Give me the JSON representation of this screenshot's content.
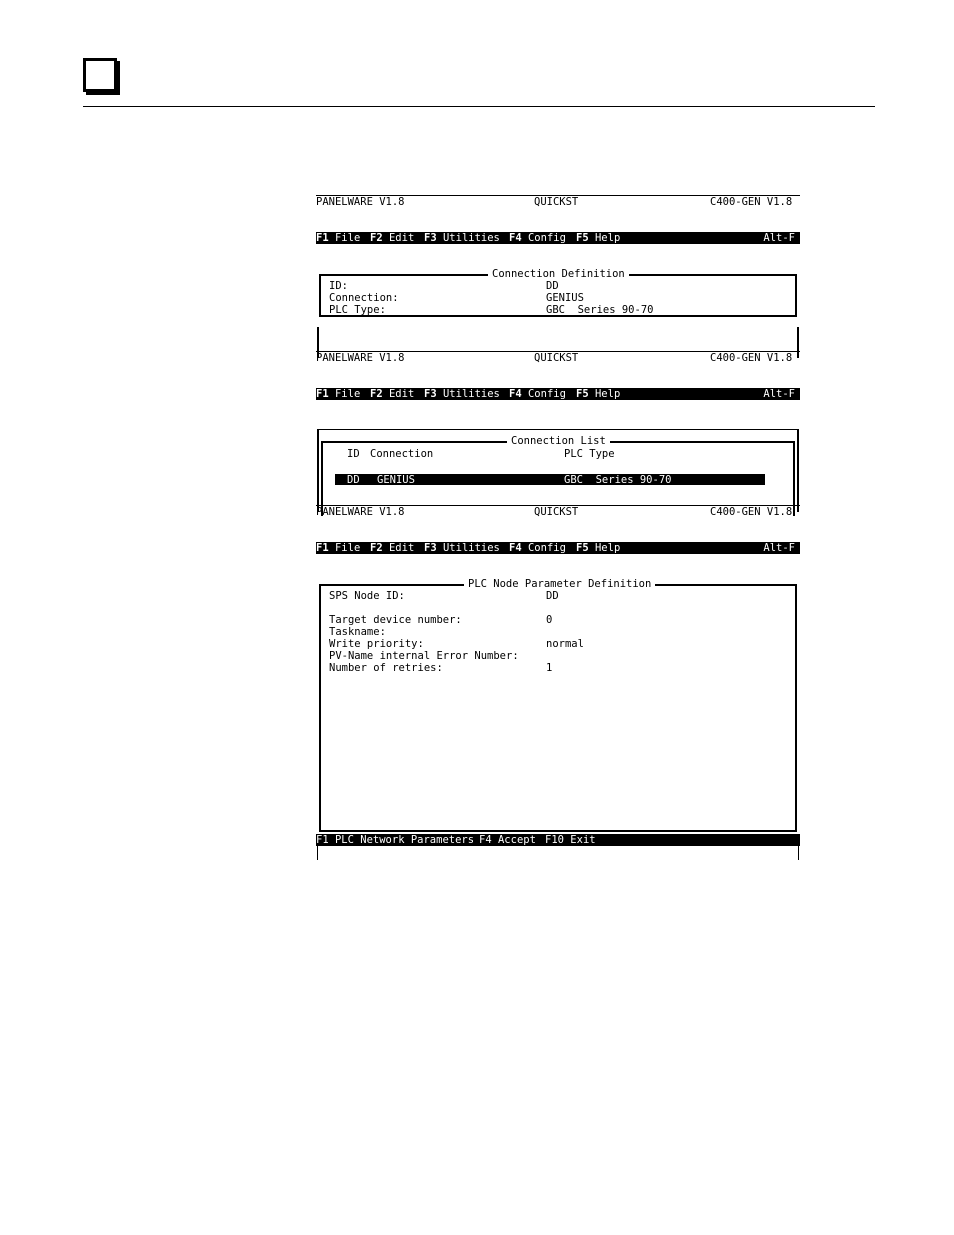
{
  "common": {
    "app_title": "PANELWARE V1.8",
    "center_title": "QUICKST",
    "right_title": "C400-GEN V1.8",
    "menu": [
      {
        "key": "F1",
        "label": "File"
      },
      {
        "key": "F2",
        "label": "Edit"
      },
      {
        "key": "F3",
        "label": "Utilities"
      },
      {
        "key": "F4",
        "label": "Config"
      },
      {
        "key": "F5",
        "label": "Help"
      }
    ],
    "shortcut": "Alt-F"
  },
  "screen1": {
    "frame_title": "Connection Definition",
    "fields": [
      {
        "label": "ID:",
        "value": "DD"
      },
      {
        "label": "Connection:",
        "value": "GENIUS"
      },
      {
        "label": "PLC Type:",
        "value": "GBC  Series 90-70"
      }
    ]
  },
  "screen2": {
    "frame_title": "Connection List",
    "headers": {
      "id": "ID",
      "connection": "Connection",
      "plc_type": "PLC Type"
    },
    "rows": [
      {
        "id": "DD",
        "connection": "GENIUS",
        "plc_type": "GBC  Series 90-70"
      }
    ]
  },
  "screen3": {
    "frame_title": "PLC Node Parameter Definition",
    "fields": [
      {
        "label": "SPS Node ID:",
        "value": "DD"
      },
      {
        "label": "Target device number:",
        "value": "0"
      },
      {
        "label": "Taskname:",
        "value": ""
      },
      {
        "label": "Write priority:",
        "value": "normal"
      },
      {
        "label": "PV-Name internal Error Number:",
        "value": ""
      },
      {
        "label": "Number of retries:",
        "value": "1"
      }
    ],
    "function_bar": [
      {
        "key": "F1",
        "label": "PLC Network Parameters"
      },
      {
        "key": "F4",
        "label": "Accept"
      },
      {
        "key": "F10",
        "label": "Exit"
      }
    ]
  }
}
